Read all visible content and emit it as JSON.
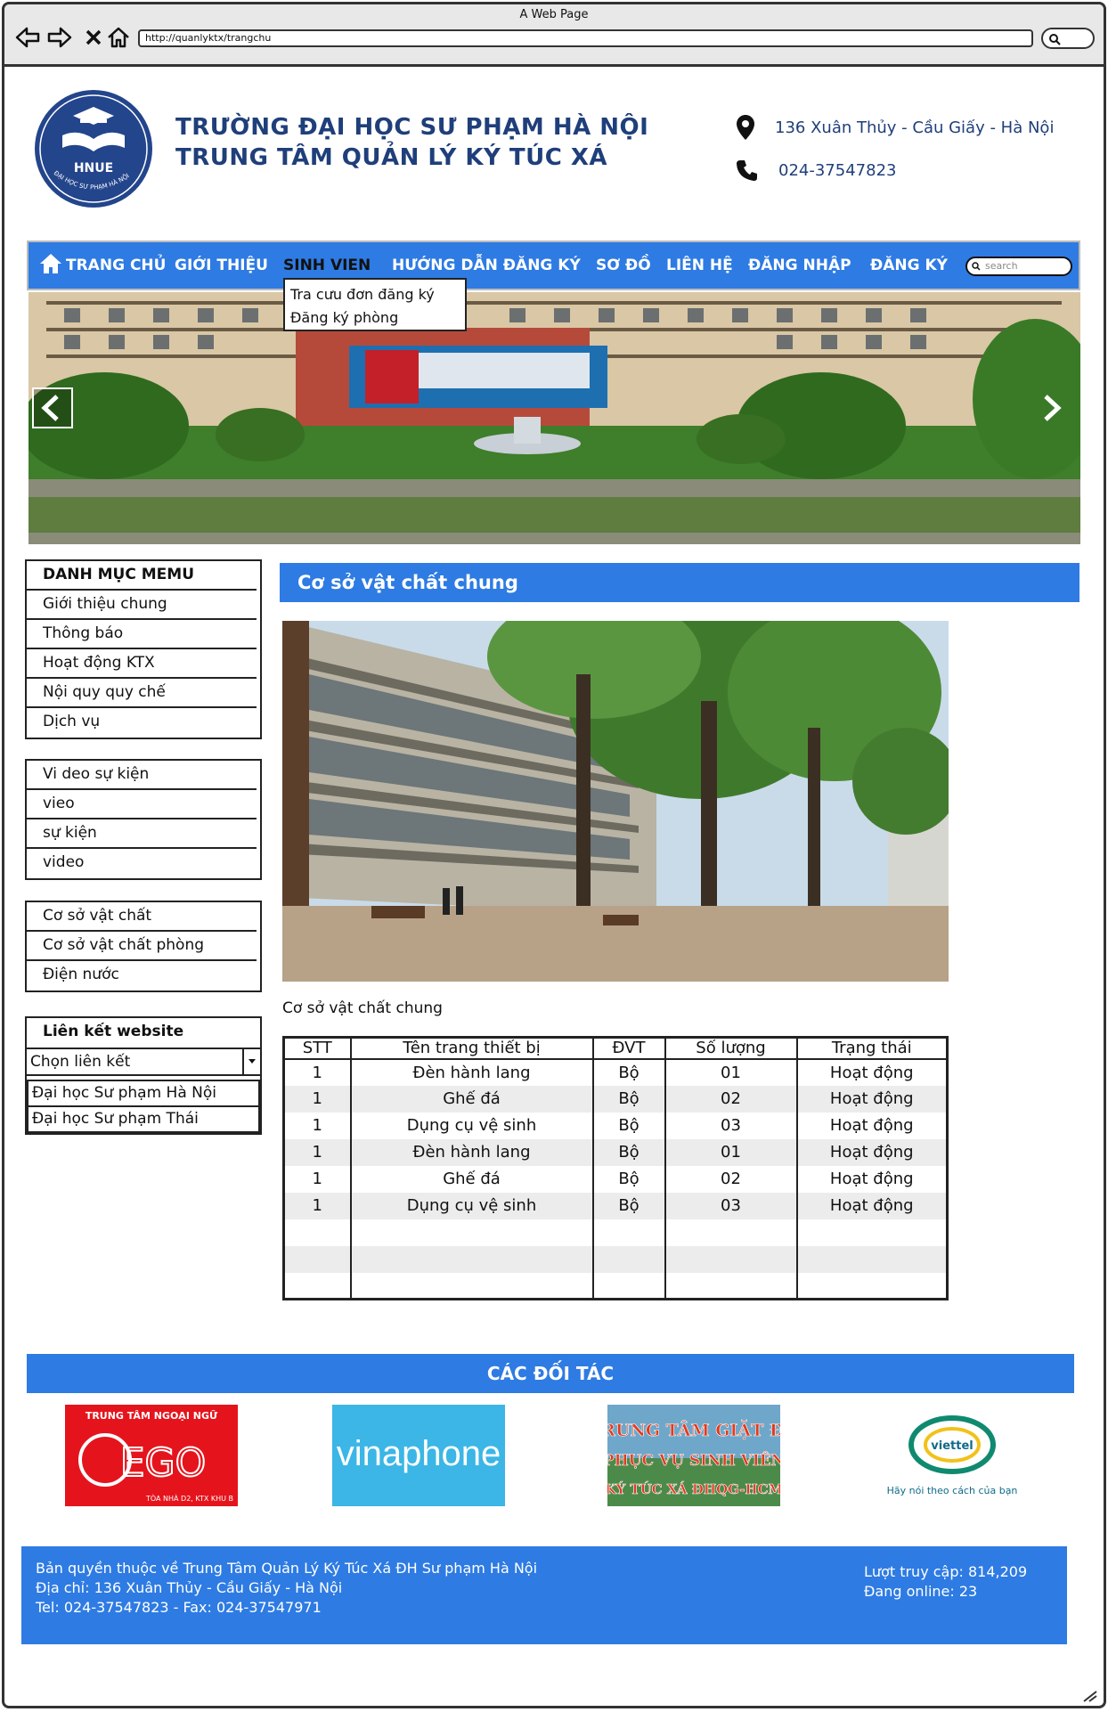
{
  "window": {
    "title": "A Web Page",
    "url": "http://quanlyktx/trangchu"
  },
  "header": {
    "logo_text": "HNUE",
    "logo_ring_text": "ĐẠI HỌC SƯ PHẠM HÀ NỘI",
    "title_line1": "TRƯỜNG ĐẠI HỌC SƯ PHẠM HÀ NỘI",
    "title_line2": "TRUNG TÂM QUẢN LÝ KÝ TÚC XÁ",
    "address": "136 Xuân Thủy - Cầu Giấy - Hà Nội",
    "phone": "024-37547823"
  },
  "nav": {
    "items": [
      "TRANG CHỦ",
      "GIỚI THIỆU",
      "SINH VIEN",
      "HƯỚNG DẪN ĐĂNG KÝ",
      "SƠ ĐỒ",
      "LIÊN HỆ",
      "ĐĂNG NHẬP",
      "ĐĂNG KÝ"
    ],
    "search_placeholder": "search",
    "dropdown": [
      "Tra cưu đơn đăng ký",
      "Đăng ký phòng"
    ]
  },
  "sidebar": {
    "menu": [
      "DANH MỤC MEMU",
      "Giới thiệu chung",
      "Thông báo",
      "Hoạt động KTX",
      "Nội quy quy chế",
      "Dịch vụ"
    ],
    "video": [
      "Vi deo sự kiện",
      "vieo",
      "sự kiện",
      "video"
    ],
    "facilities": [
      "Cơ sở vật chất",
      "Cơ sở vật chất phòng",
      "Điện nước"
    ],
    "links": {
      "title": "Liên kết website",
      "select_value": "Chọn liên kết",
      "options": [
        "Đại học Sư phạm Hà Nội",
        "Đại học Sư phạm Thái"
      ]
    }
  },
  "main": {
    "heading": "Cơ sở vật chất chung",
    "caption": "Cơ sở vật chất chung",
    "table": {
      "headers": [
        "STT",
        "Tên trang thiết bị",
        "ĐVT",
        "Số lượng",
        "Trạng thái"
      ],
      "rows": [
        [
          "1",
          "Đèn hành lang",
          "Bộ",
          "01",
          "Hoạt động"
        ],
        [
          "1",
          "Ghế đá",
          "Bộ",
          "02",
          "Hoạt động"
        ],
        [
          "1",
          "Dụng cụ vệ sinh",
          "Bộ",
          "03",
          "Hoạt động"
        ],
        [
          "1",
          "Đèn hành lang",
          "Bộ",
          "01",
          "Hoạt động"
        ],
        [
          "1",
          "Ghế đá",
          "Bộ",
          "02",
          "Hoạt động"
        ],
        [
          "1",
          "Dụng cụ vệ sinh",
          "Bộ",
          "03",
          "Hoạt động"
        ],
        [
          "",
          "",
          "",
          "",
          ""
        ],
        [
          "",
          "",
          "",
          "",
          ""
        ],
        [
          "",
          "",
          "",
          "",
          ""
        ]
      ]
    }
  },
  "partners": {
    "heading": "CÁC ĐỐI TÁC",
    "items": [
      {
        "name": "ego-logo",
        "top_text": "TRUNG TÂM NGOẠI NGỮ",
        "brand": "EGO",
        "sub_text": "TÒA NHÀ D2, KTX KHU B"
      },
      {
        "name": "vinaphone-logo",
        "brand": "vinaphone"
      },
      {
        "name": "giat-do-logo",
        "line1": "TRUNG TÂM GIẶT ĐỒ",
        "line2": "PHỤC VỤ SINH VIÊN",
        "line3": "KÝ TÚC XÁ ĐHQG-HCM"
      },
      {
        "name": "viettel-logo",
        "brand": "viettel",
        "slogan": "Hãy nói theo cách của bạn"
      }
    ]
  },
  "footer": {
    "copyright": "Bản quyền thuộc về Trung Tâm Quản Lý Ký Túc Xá ĐH Sư phạm Hà Nội",
    "address": "Địa chỉ: 136 Xuân Thủy - Cầu Giấy - Hà Nội",
    "tel": "Tel: 024-37547823 - Fax: 024-37547971",
    "visits": "Lượt truy cập: 814,209",
    "online": "Đang online: 23"
  },
  "colors": {
    "primary": "#2e7be3",
    "title": "#1f3f7a",
    "frame": "#333333"
  }
}
